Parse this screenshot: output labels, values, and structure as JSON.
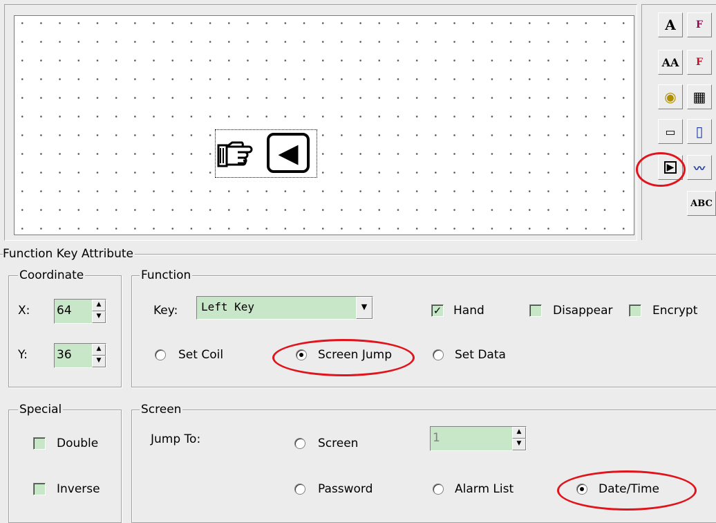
{
  "canvas": {
    "key_glyph": "◀"
  },
  "toolbox": {
    "items": [
      {
        "name": "text-tool-icon",
        "glyph": "A"
      },
      {
        "name": "font-tool-icon",
        "glyph": "F"
      },
      {
        "name": "dynamic-text-icon",
        "glyph": "AA"
      },
      {
        "name": "dynamic-font-icon",
        "glyph": "F"
      },
      {
        "name": "lamp-icon",
        "glyph": "◉"
      },
      {
        "name": "bitmap-icon",
        "glyph": "▦"
      },
      {
        "name": "data-display-icon",
        "glyph": "▭"
      },
      {
        "name": "bar-icon",
        "glyph": "▯"
      },
      {
        "name": "function-key-icon",
        "glyph": "▶"
      },
      {
        "name": "trend-chart-icon",
        "glyph": "〰"
      },
      {
        "name": "abc-text-icon",
        "glyph": "ABC"
      }
    ]
  },
  "panel": {
    "title": "Function Key Attribute",
    "coordinate": {
      "legend": "Coordinate",
      "x_label": "X:",
      "x_value": "64",
      "y_label": "Y:",
      "y_value": "36"
    },
    "function": {
      "legend": "Function",
      "key_label": "Key:",
      "key_value": "Left Key",
      "hand_label": "Hand",
      "disappear_label": "Disappear",
      "encrypt_label": "Encrypt",
      "set_coil_label": "Set Coil",
      "screen_jump_label": "Screen Jump",
      "set_data_label": "Set Data"
    },
    "special": {
      "legend": "Special",
      "double_label": "Double",
      "inverse_label": "Inverse"
    },
    "screen": {
      "legend": "Screen",
      "jump_to_label": "Jump To:",
      "screen_label": "Screen",
      "screen_value": "1",
      "password_label": "Password",
      "alarm_list_label": "Alarm List",
      "date_time_label": "Date/Time"
    }
  },
  "colors": {
    "highlight": "#e0141c",
    "field_green": "#c8e6c8"
  }
}
